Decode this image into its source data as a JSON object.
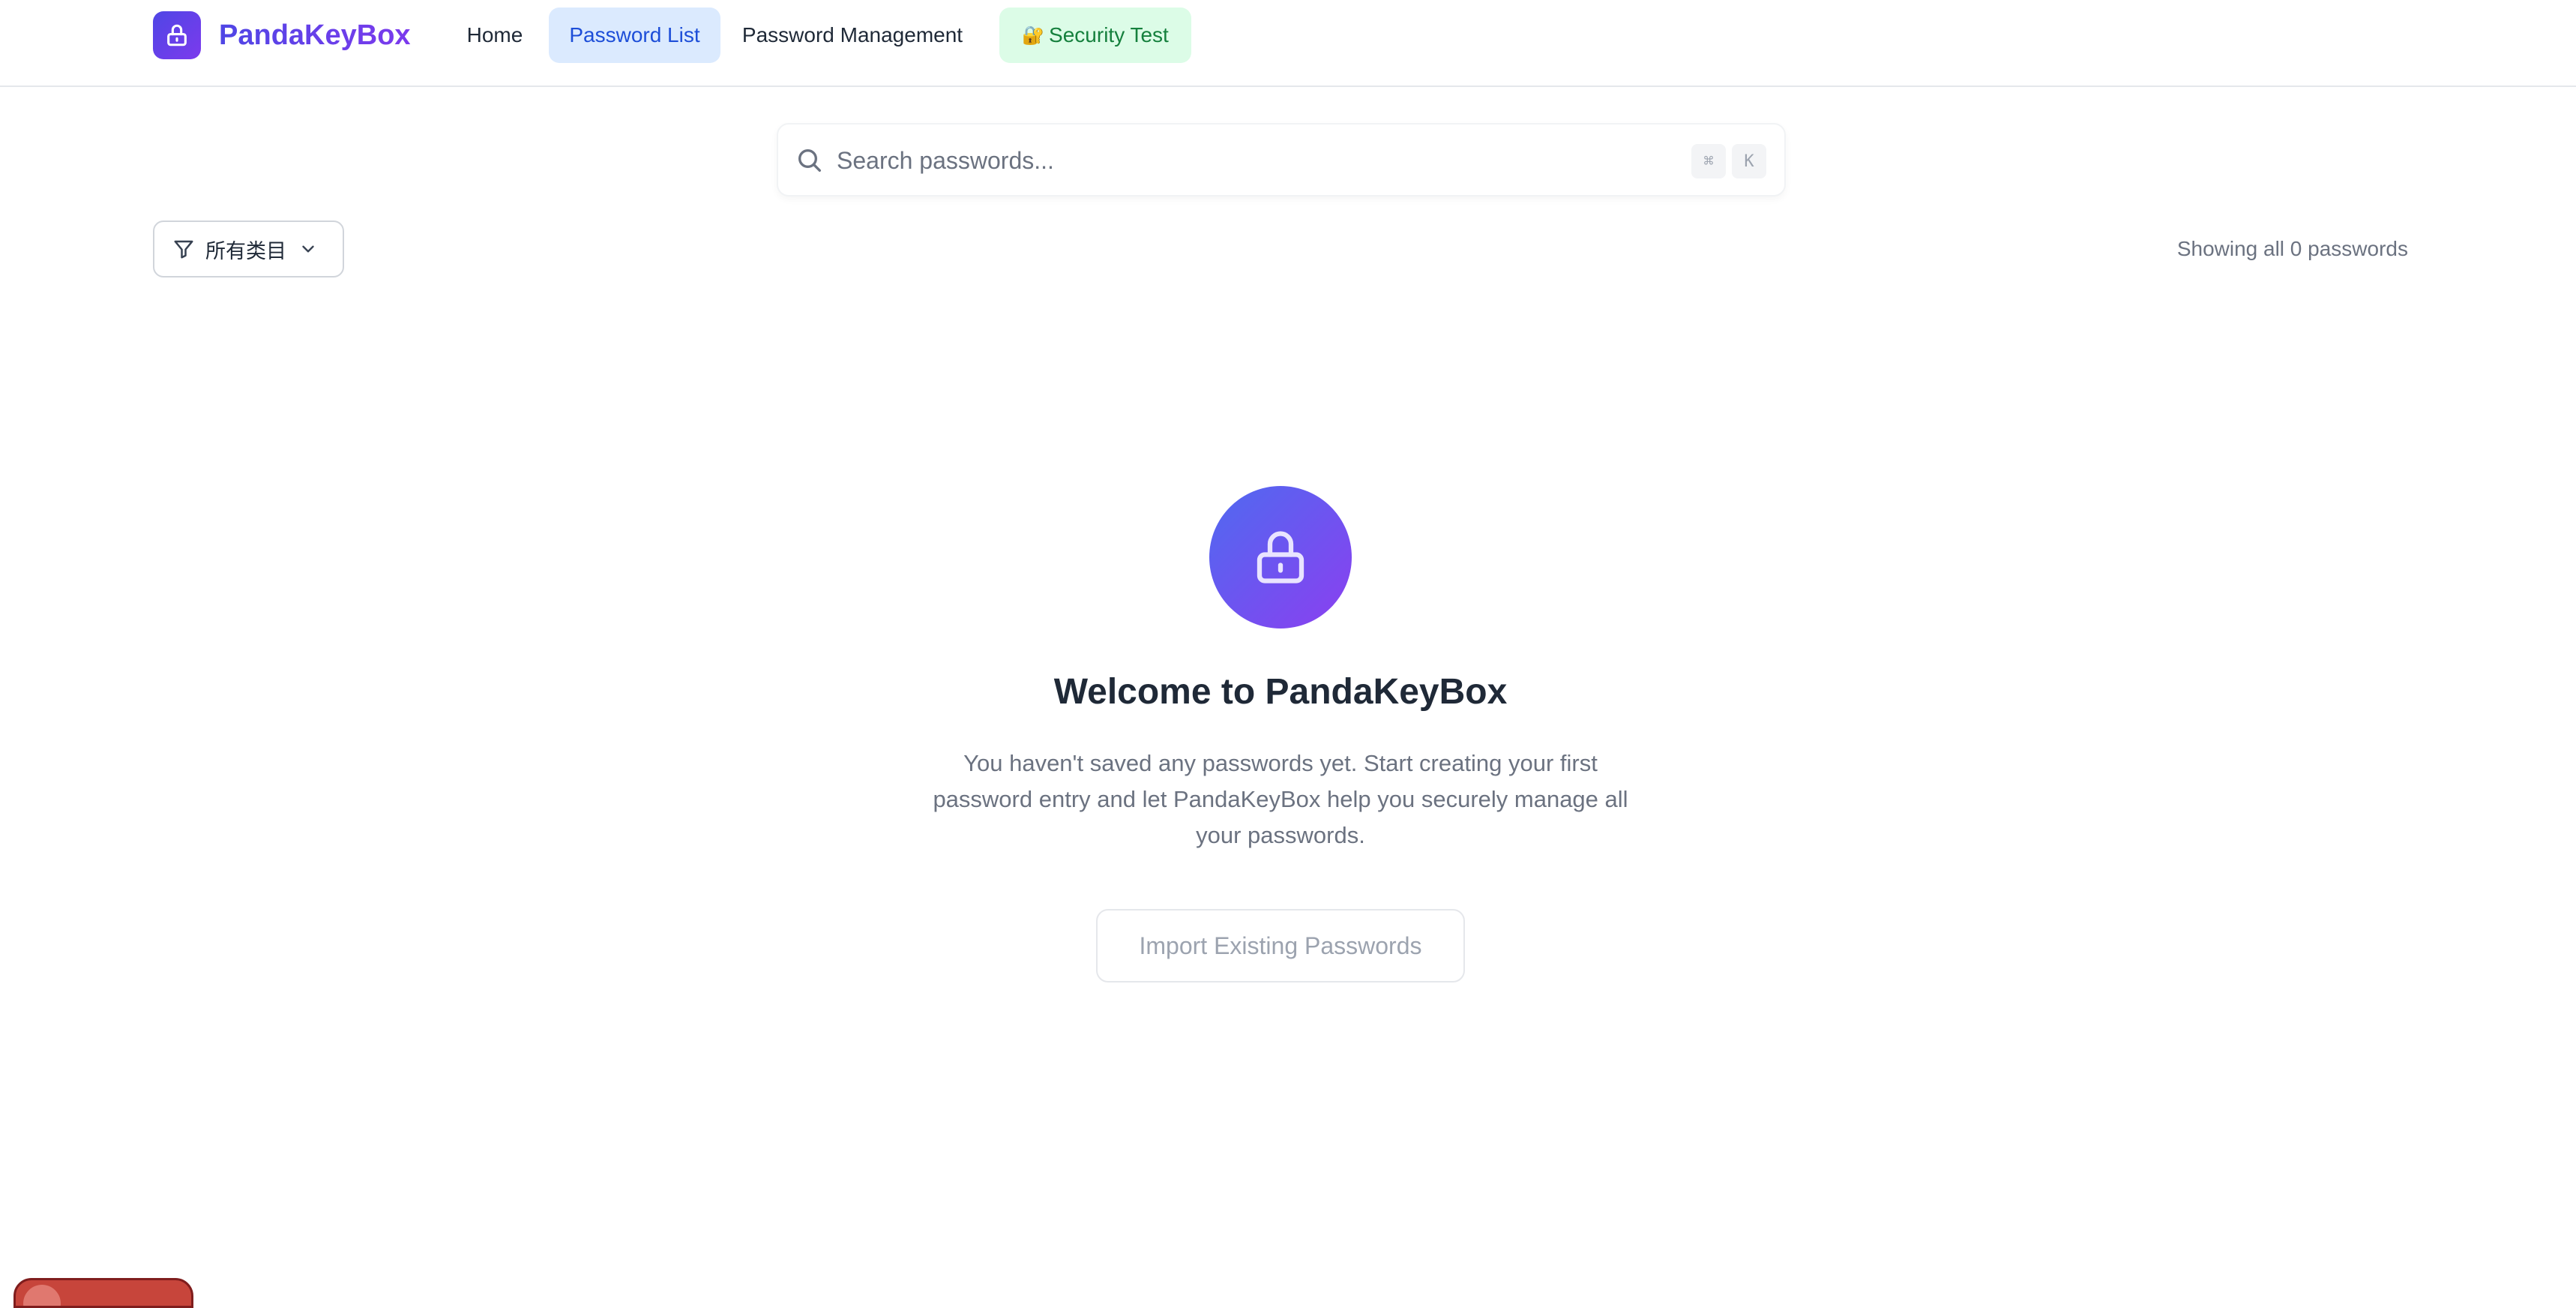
{
  "app": {
    "brand": "PandaKeyBox",
    "brand_gradient": [
      "#4f46e5",
      "#7c3aed"
    ]
  },
  "nav": {
    "items": [
      {
        "label": "Home",
        "active": false
      },
      {
        "label": "Password List",
        "active": true
      },
      {
        "label": "Password Management",
        "active": false
      },
      {
        "label": "Security Test",
        "icon": "🔐",
        "active": false
      }
    ]
  },
  "search": {
    "placeholder": "Search passwords...",
    "value": "",
    "shortcut": [
      "⌘",
      "K"
    ]
  },
  "filter": {
    "label": "所有类目",
    "icon": "filter-icon"
  },
  "list": {
    "count_text": "Showing all 0 passwords"
  },
  "empty_state": {
    "icon": "lock-icon",
    "title": "Welcome to PandaKeyBox",
    "description": "You haven't saved any passwords yet. Start creating your first password entry and let PandaKeyBox help you securely manage all your passwords.",
    "action_label": "Import Existing Passwords"
  },
  "colors": {
    "accent": "#4f46e5",
    "active_nav_bg": "#dbeafe",
    "security_bg": "#dcfce7",
    "security_text": "#15803d"
  }
}
